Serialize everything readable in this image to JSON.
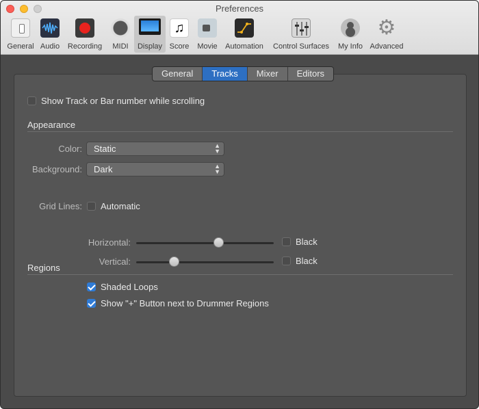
{
  "window": {
    "title": "Preferences"
  },
  "toolbar": {
    "items": [
      {
        "label": "General",
        "icon": "general-switch-icon"
      },
      {
        "label": "Audio",
        "icon": "audio-waveform-icon"
      },
      {
        "label": "Recording",
        "icon": "record-icon"
      },
      {
        "label": "MIDI",
        "icon": "midi-port-icon"
      },
      {
        "label": "Display",
        "icon": "display-monitor-icon",
        "selected": true
      },
      {
        "label": "Score",
        "icon": "music-note-icon"
      },
      {
        "label": "Movie",
        "icon": "movie-camera-icon"
      },
      {
        "label": "Automation",
        "icon": "automation-curve-icon"
      },
      {
        "label": "Control Surfaces",
        "icon": "control-surfaces-icon"
      },
      {
        "label": "My Info",
        "icon": "user-icon"
      },
      {
        "label": "Advanced",
        "icon": "gear-icon"
      }
    ]
  },
  "tabs": [
    {
      "label": "General"
    },
    {
      "label": "Tracks",
      "active": true
    },
    {
      "label": "Mixer"
    },
    {
      "label": "Editors"
    }
  ],
  "options": {
    "show_track_number": {
      "label": "Show Track or Bar number while scrolling",
      "checked": false
    }
  },
  "appearance": {
    "heading": "Appearance",
    "color": {
      "label": "Color:",
      "value": "Static"
    },
    "background": {
      "label": "Background:",
      "value": "Dark"
    },
    "grid_lines": {
      "label": "Grid Lines:",
      "automatic": {
        "label": "Automatic",
        "checked": false
      },
      "horizontal": {
        "label": "Horizontal:",
        "level": 0.6,
        "black_label": "Black",
        "black_checked": false
      },
      "vertical": {
        "label": "Vertical:",
        "level": 0.28,
        "black_label": "Black",
        "black_checked": false
      }
    }
  },
  "regions": {
    "heading": "Regions",
    "shaded_loops": {
      "label": "Shaded Loops",
      "checked": true
    },
    "drummer_button": {
      "label": "Show \"+\" Button next to Drummer Regions",
      "checked": true
    }
  },
  "colors": {
    "accent": "#2d6fc2",
    "panel_bg": "#555555",
    "window_bg": "#4a4a4a"
  }
}
